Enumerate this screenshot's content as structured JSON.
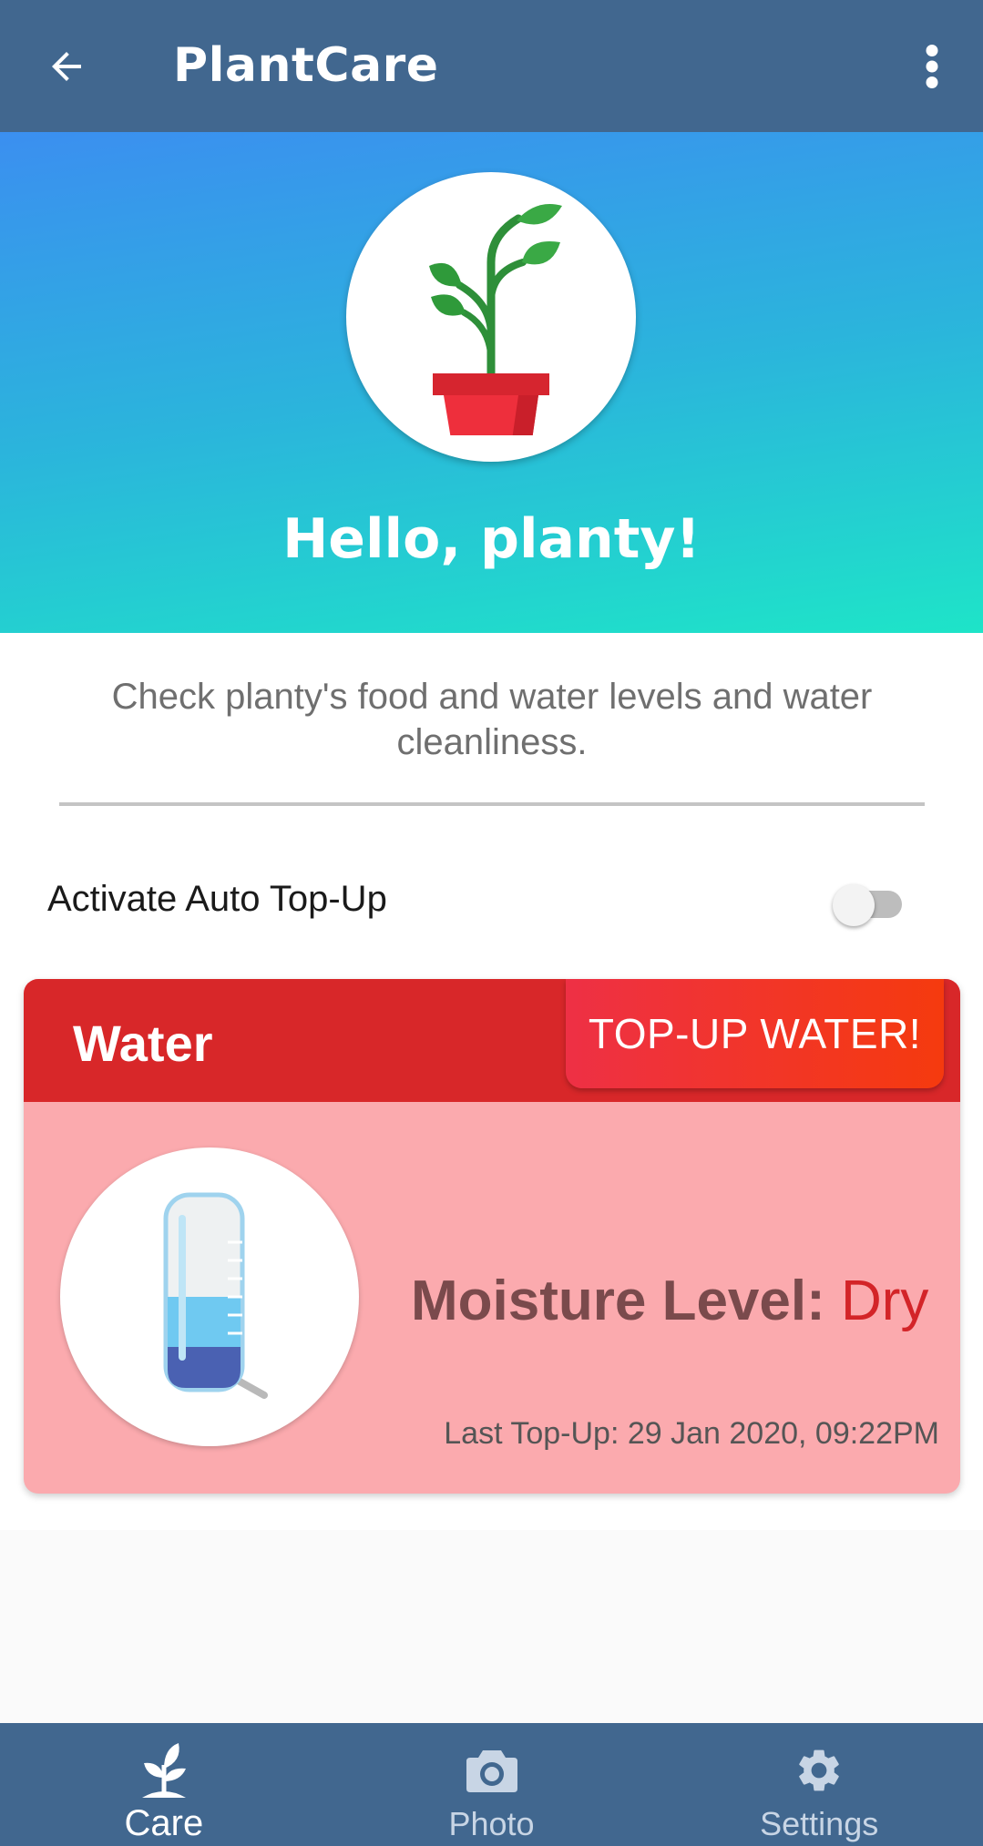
{
  "appbar": {
    "title": "PlantCare",
    "back_icon": "arrow-left-icon",
    "more_icon": "more-vertical-icon"
  },
  "hero": {
    "greeting": "Hello, planty!",
    "avatar_icon": "potted-plant-icon"
  },
  "description": "Check planty's food and water levels and water cleanliness.",
  "auto_topup": {
    "label": "Activate Auto Top-Up",
    "enabled": false
  },
  "water_card": {
    "title": "Water",
    "action_label": "TOP-UP WATER!",
    "moisture_label": "Moisture Level:",
    "moisture_value": "Dry",
    "last_topup": "Last Top-Up: 29 Jan 2020, 09:22PM",
    "icon": "water-bottle-icon",
    "fill_fraction": 0.4
  },
  "bottom_nav": {
    "items": [
      {
        "label": "Care",
        "icon": "sprout-icon",
        "active": true
      },
      {
        "label": "Photo",
        "icon": "camera-icon",
        "active": false
      },
      {
        "label": "Settings",
        "icon": "gear-icon",
        "active": false
      }
    ]
  },
  "colors": {
    "appbar": "#41678f",
    "card_header": "#d82729",
    "card_body": "#fbaaae",
    "moisture_value": "#d32428"
  }
}
